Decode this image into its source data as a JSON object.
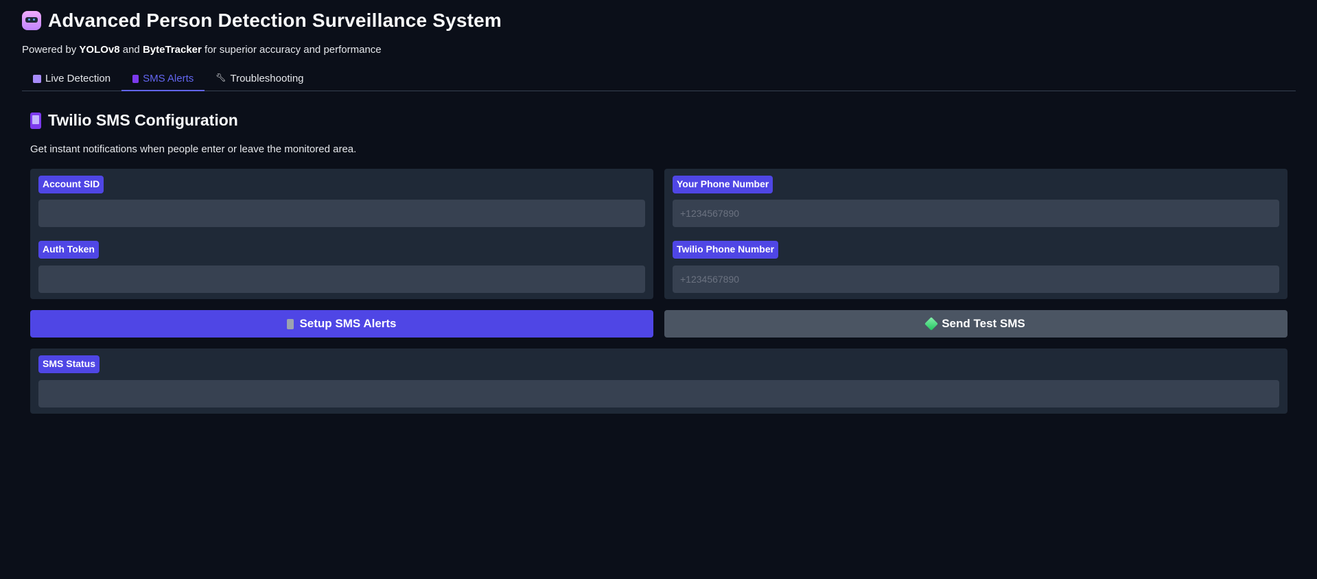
{
  "header": {
    "icon": "robot-icon",
    "title": "Advanced Person Detection Surveillance System",
    "subtitle_prefix": "Powered by ",
    "subtitle_bold1": "YOLOv8",
    "subtitle_mid": " and ",
    "subtitle_bold2": "ByteTracker",
    "subtitle_suffix": " for superior accuracy and performance"
  },
  "tabs": [
    {
      "label": "Live Detection",
      "icon": "camera-icon",
      "active": false
    },
    {
      "label": "SMS Alerts",
      "icon": "phone-icon",
      "active": true
    },
    {
      "label": "Troubleshooting",
      "icon": "wrench-icon",
      "active": false
    }
  ],
  "sms": {
    "section_title": "Twilio SMS Configuration",
    "section_desc": "Get instant notifications when people enter or leave the monitored area.",
    "account_sid": {
      "label": "Account SID",
      "value": "",
      "placeholder": ""
    },
    "auth_token": {
      "label": "Auth Token",
      "value": "",
      "placeholder": ""
    },
    "your_phone": {
      "label": "Your Phone Number",
      "value": "",
      "placeholder": "+1234567890"
    },
    "twilio_phone": {
      "label": "Twilio Phone Number",
      "value": "",
      "placeholder": "+1234567890"
    },
    "setup_button": "Setup SMS Alerts",
    "test_button": "Send Test SMS",
    "status": {
      "label": "SMS Status",
      "value": ""
    }
  },
  "colors": {
    "background": "#0b0f19",
    "panel": "#1f2937",
    "input": "#374151",
    "accent": "#4f46e5",
    "secondary_button": "#4b5563"
  }
}
